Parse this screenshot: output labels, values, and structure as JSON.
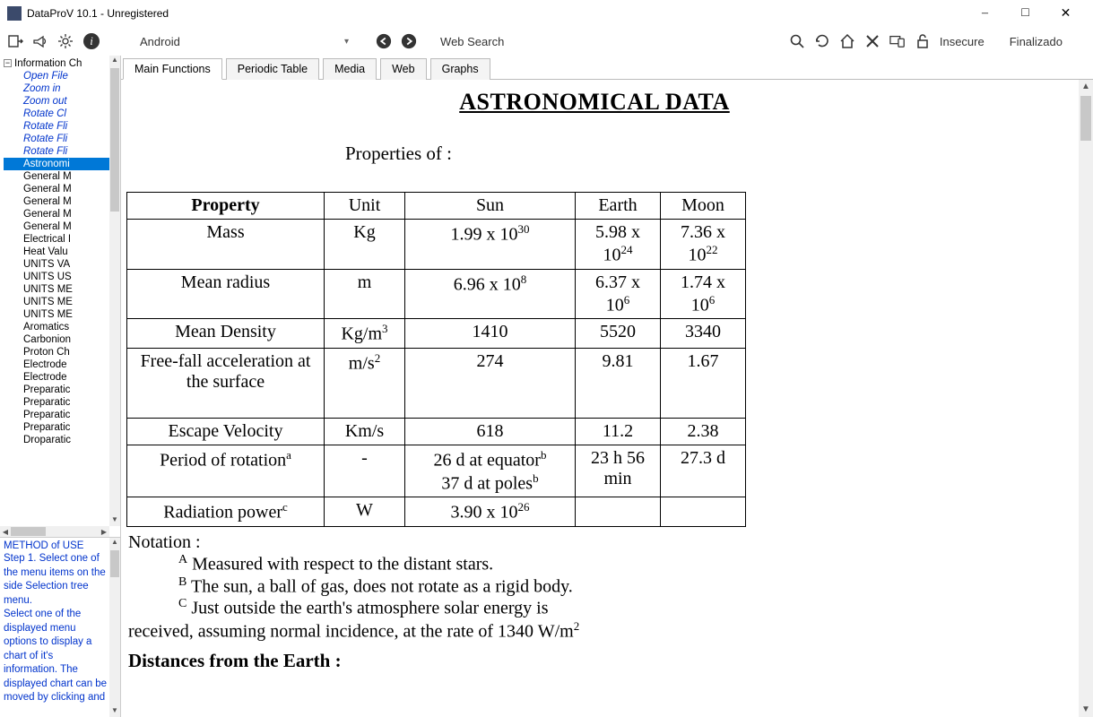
{
  "window": {
    "title": "DataProV 10.1 - Unregistered"
  },
  "toolbar": {
    "platform": "Android",
    "websearch": "Web Search",
    "insecure": "Insecure",
    "finalizado": "Finalizado"
  },
  "tabs": [
    {
      "id": "main",
      "label": "Main Functions",
      "active": true
    },
    {
      "id": "periodic",
      "label": "Periodic Table",
      "active": false
    },
    {
      "id": "media",
      "label": "Media",
      "active": false
    },
    {
      "id": "web",
      "label": "Web",
      "active": false
    },
    {
      "id": "graphs",
      "label": "Graphs",
      "active": false
    }
  ],
  "tree": {
    "root": "Information Ch",
    "items": [
      {
        "label": "Open File",
        "style": "link"
      },
      {
        "label": "Zoom in",
        "style": "link"
      },
      {
        "label": "Zoom out",
        "style": "link"
      },
      {
        "label": "Rotate Cl",
        "style": "link"
      },
      {
        "label": "Rotate Fli",
        "style": "link"
      },
      {
        "label": "Rotate Fli",
        "style": "link"
      },
      {
        "label": "Rotate Fli",
        "style": "link"
      },
      {
        "label": "Astronomi",
        "style": "selected"
      },
      {
        "label": "General M",
        "style": "plain"
      },
      {
        "label": "General M",
        "style": "plain"
      },
      {
        "label": "General M",
        "style": "plain"
      },
      {
        "label": "General M",
        "style": "plain"
      },
      {
        "label": "General M",
        "style": "plain"
      },
      {
        "label": "Electrical I",
        "style": "plain"
      },
      {
        "label": "Heat Valu",
        "style": "plain"
      },
      {
        "label": "UNITS VA",
        "style": "plain"
      },
      {
        "label": "UNITS US",
        "style": "plain"
      },
      {
        "label": "UNITS ME",
        "style": "plain"
      },
      {
        "label": "UNITS ME",
        "style": "plain"
      },
      {
        "label": "UNITS ME",
        "style": "plain"
      },
      {
        "label": "Aromatics",
        "style": "plain"
      },
      {
        "label": "Carbonion",
        "style": "plain"
      },
      {
        "label": "Proton Ch",
        "style": "plain"
      },
      {
        "label": "Electrode",
        "style": "plain"
      },
      {
        "label": "Electrode",
        "style": "plain"
      },
      {
        "label": "Preparatic",
        "style": "plain"
      },
      {
        "label": "Preparatic",
        "style": "plain"
      },
      {
        "label": "Preparatic",
        "style": "plain"
      },
      {
        "label": "Preparatic",
        "style": "plain"
      },
      {
        "label": "Droparatic",
        "style": "plain"
      }
    ]
  },
  "help": {
    "title": "METHOD of USE",
    "body": "Step 1. Select one of the menu items on the side Selection tree menu.\nSelect one of the displayed menu options to display a chart of it's information. The displayed chart can be moved by clicking and"
  },
  "doc": {
    "title": "ASTRONOMICAL DATA",
    "subtitle": "Properties of :",
    "headers": [
      "Property",
      "Unit",
      "Sun",
      "Earth",
      "Moon"
    ],
    "rows": [
      {
        "property": "Mass",
        "unit": "Kg",
        "sun_html": "1.99 x 10<sup>30</sup>",
        "earth_html": "5.98 x 10<sup>24</sup>",
        "moon_html": "7.36 x 10<sup>22</sup>"
      },
      {
        "property": "Mean radius",
        "unit": "m",
        "sun_html": "6.96 x 10<sup>8</sup>",
        "earth_html": "6.37 x 10<sup>6</sup>",
        "moon_html": "1.74 x 10<sup>6</sup>"
      },
      {
        "property": "Mean Density",
        "unit_html": "Kg/m<sup>3</sup>",
        "sun_html": "1410",
        "earth_html": "5520",
        "moon_html": "3340"
      },
      {
        "property": "Free-fall acceleration at the surface",
        "unit_html": "m/s<sup>2</sup>",
        "sun_html": "274",
        "earth_html": "9.81",
        "moon_html": "1.67",
        "tall": true
      },
      {
        "property": "Escape Velocity",
        "unit": "Km/s",
        "sun_html": "618",
        "earth_html": "11.2",
        "moon_html": "2.38"
      },
      {
        "property_html": "Period of rotation<sup>a</sup>",
        "unit": "-",
        "sun_html": "26 d at equator<sup>b</sup><br>37 d at poles<sup>b</sup>",
        "earth_html": "23 h 56 min",
        "moon_html": "27.3 d"
      },
      {
        "property_html": "Radiation power<sup>c</sup>",
        "unit": "W",
        "sun_html": "3.90 x 10<sup>26</sup>",
        "earth_html": "",
        "moon_html": ""
      }
    ],
    "notation_label": "Notation :",
    "foot_a": "Measured with respect to the distant stars.",
    "foot_b": "The sun, a ball of gas, does not rotate as a rigid body.",
    "foot_c_1": "Just outside the earth's atmosphere solar energy is",
    "foot_c_2_html": "received, assuming normal incidence, at the rate of 1340 W/m<sup>2</sup>",
    "section2": "Distances from the Earth :"
  },
  "chart_data": {
    "type": "table",
    "title": "ASTRONOMICAL DATA — Properties of",
    "columns": [
      "Property",
      "Unit",
      "Sun",
      "Earth",
      "Moon"
    ],
    "rows": [
      [
        "Mass",
        "Kg",
        "1.99e30",
        "5.98e24",
        "7.36e22"
      ],
      [
        "Mean radius",
        "m",
        "6.96e8",
        "6.37e6",
        "1.74e6"
      ],
      [
        "Mean Density",
        "Kg/m^3",
        1410,
        5520,
        3340
      ],
      [
        "Free-fall acceleration at the surface",
        "m/s^2",
        274,
        9.81,
        1.67
      ],
      [
        "Escape Velocity",
        "Km/s",
        618,
        11.2,
        2.38
      ],
      [
        "Period of rotation",
        "-",
        "26 d at equator; 37 d at poles",
        "23 h 56 min",
        "27.3 d"
      ],
      [
        "Radiation power",
        "W",
        "3.90e26",
        "",
        ""
      ]
    ],
    "footnotes": {
      "a": "Measured with respect to the distant stars.",
      "b": "The sun, a ball of gas, does not rotate as a rigid body.",
      "c": "Just outside the earth's atmosphere solar energy is received, assuming normal incidence, at the rate of 1340 W/m^2"
    }
  }
}
